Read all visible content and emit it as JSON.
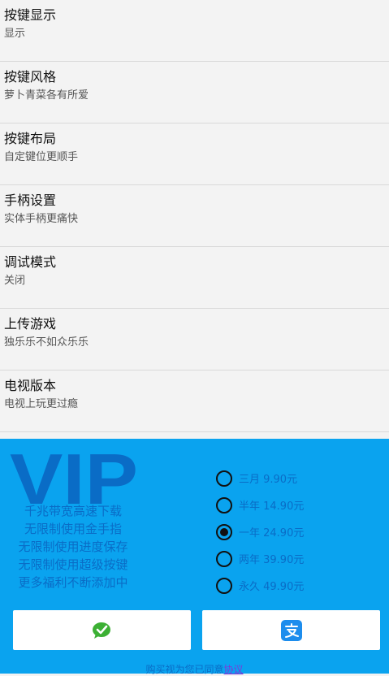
{
  "settings": {
    "items": [
      {
        "title": "按键显示",
        "subtitle": "显示"
      },
      {
        "title": "按键风格",
        "subtitle": "萝卜青菜各有所爱"
      },
      {
        "title": "按键布局",
        "subtitle": "自定键位更顺手"
      },
      {
        "title": "手柄设置",
        "subtitle": "实体手柄更痛快"
      },
      {
        "title": "调试模式",
        "subtitle": "关闭"
      },
      {
        "title": "上传游戏",
        "subtitle": "独乐乐不如众乐乐"
      },
      {
        "title": "电视版本",
        "subtitle": "电视上玩更过瘾"
      }
    ]
  },
  "vip": {
    "logo_text": "VIP",
    "benefits": [
      "千兆带宽高速下载",
      "无限制使用金手指",
      "无限制使用进度保存",
      "无限制使用超级按键",
      "更多福利不断添加中"
    ],
    "plans": [
      {
        "label": "三月 9.90元",
        "selected": false
      },
      {
        "label": "半年 14.90元",
        "selected": false
      },
      {
        "label": "一年 24.90元",
        "selected": true
      },
      {
        "label": "两年 39.90元",
        "selected": false
      },
      {
        "label": "永久 49.90元",
        "selected": false
      }
    ],
    "agreement_prefix": "购买视为您已同意",
    "agreement_link": "协议",
    "colors": {
      "panel": "#0aa3ef",
      "text": "#0a6cc6",
      "wechat": "#3cb034",
      "alipay": "#1d8ded"
    }
  }
}
